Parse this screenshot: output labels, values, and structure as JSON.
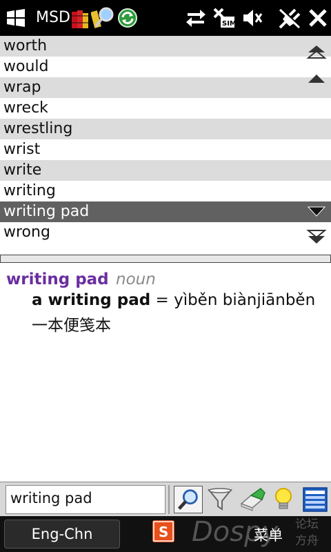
{
  "statusbar": {
    "app_title": "MSD",
    "icons": [
      "windows-start-icon",
      "dictionary-books-icon",
      "magnifier-icon",
      "sync-icon",
      "data-transfer-icon",
      "no-sim-icon",
      "speaker-muted-icon",
      "power-plug-icon",
      "close-icon"
    ]
  },
  "wordlist": {
    "items": [
      {
        "label": "worth"
      },
      {
        "label": "would"
      },
      {
        "label": "wrap"
      },
      {
        "label": "wreck"
      },
      {
        "label": "wrestling"
      },
      {
        "label": "wrist"
      },
      {
        "label": "write"
      },
      {
        "label": "writing"
      },
      {
        "label": "writing pad"
      },
      {
        "label": "wrong"
      }
    ],
    "selected_index": 8
  },
  "definition": {
    "headword": "writing pad",
    "part_of_speech": "noun",
    "example_phrase": "a writing pad",
    "example_equals": " = yìběn biànjiānběn",
    "example_chinese": "一本便笺本"
  },
  "search": {
    "value": "writing pad"
  },
  "softkeys": {
    "left_label": "Eng-Chn",
    "right_label": "菜单"
  },
  "watermark": {
    "text": "Dospy",
    "chinese_line1": "论坛",
    "chinese_line2": "方舟"
  },
  "colors": {
    "headword": "#6a2ea0",
    "selected_row": "#616161",
    "alt_row": "#dcdcdc"
  }
}
